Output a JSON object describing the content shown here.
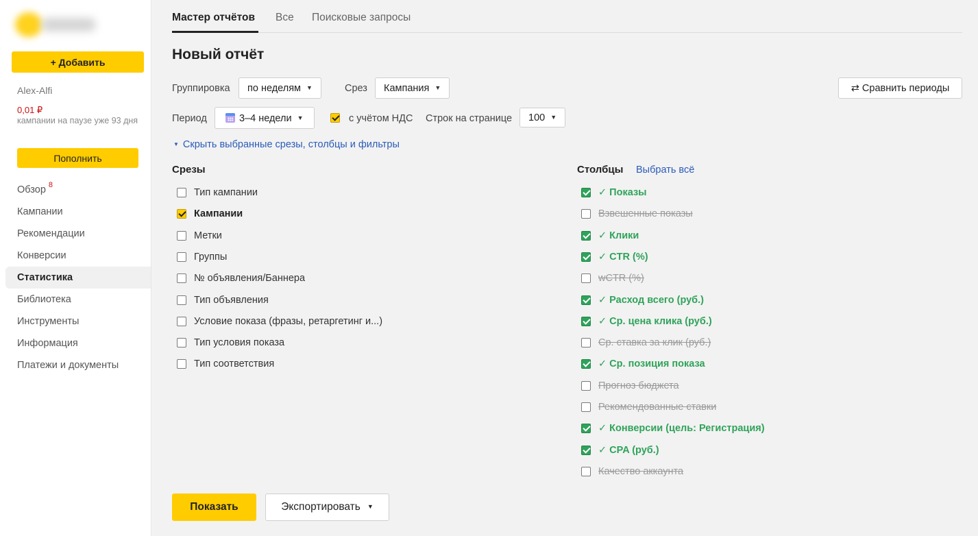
{
  "sidebar": {
    "add_label": "+ Добавить",
    "user": "Alex-Alfi",
    "balance": "0,01 ₽",
    "balance_note": "кампании на паузе уже 93 дня",
    "topup_label": "Пополнить",
    "nav": [
      {
        "label": "Обзор",
        "badge": "8"
      },
      {
        "label": "Кампании"
      },
      {
        "label": "Рекомендации"
      },
      {
        "label": "Конверсии"
      },
      {
        "label": "Статистика",
        "active": true
      },
      {
        "label": "Библиотека"
      },
      {
        "label": "Инструменты"
      },
      {
        "label": "Информация"
      },
      {
        "label": "Платежи и документы"
      }
    ]
  },
  "tabs": [
    {
      "label": "Мастер отчётов",
      "active": true
    },
    {
      "label": "Все"
    },
    {
      "label": "Поисковые запросы"
    }
  ],
  "page_title": "Новый отчёт",
  "filters": {
    "grouping_label": "Группировка",
    "grouping_value": "по неделям",
    "slice_label": "Срез",
    "slice_value": "Кампания",
    "compare_label": "⇄ Сравнить периоды",
    "period_label": "Период",
    "period_value": "3–4 недели",
    "vat_label": "с учётом НДС",
    "vat_checked": true,
    "rows_label": "Строк на странице",
    "rows_value": "100",
    "toggle_link": "Скрыть выбранные срезы, столбцы и фильтры"
  },
  "slices": {
    "title": "Срезы",
    "items": [
      {
        "label": "Тип кампании",
        "checked": false
      },
      {
        "label": "Кампании",
        "checked": true
      },
      {
        "label": "Метки",
        "checked": false
      },
      {
        "label": "Группы",
        "checked": false
      },
      {
        "label": "№ объявления/Баннера",
        "checked": false
      },
      {
        "label": "Тип объявления",
        "checked": false
      },
      {
        "label": "Условие показа (фразы, ретаргетинг и...)",
        "checked": false
      },
      {
        "label": "Тип условия показа",
        "checked": false
      },
      {
        "label": "Тип соответствия",
        "checked": false
      }
    ]
  },
  "columns": {
    "title": "Столбцы",
    "select_all": "Выбрать всё",
    "items": [
      {
        "label": "✓ Показы",
        "checked": true
      },
      {
        "label": "Взвешенные показы",
        "checked": false
      },
      {
        "label": "✓ Клики",
        "checked": true
      },
      {
        "label": "✓ CTR (%)",
        "checked": true
      },
      {
        "label": "wCTR (%)",
        "checked": false
      },
      {
        "label": "✓ Расход всего (руб.)",
        "checked": true
      },
      {
        "label": "✓ Ср. цена клика (руб.)",
        "checked": true
      },
      {
        "label": "Ср. ставка за клик (руб.)",
        "checked": false
      },
      {
        "label": "✓ Ср. позиция показа",
        "checked": true
      },
      {
        "label": "Прогноз бюджета",
        "checked": false
      },
      {
        "label": "Рекомендованные ставки",
        "checked": false
      },
      {
        "label": "✓ Конверсии (цель: Регистрация)",
        "checked": true
      },
      {
        "label": "✓ CPA (руб.)",
        "checked": true
      },
      {
        "label": "Качество аккаунта",
        "checked": false
      }
    ]
  },
  "actions": {
    "show_label": "Показать",
    "export_label": "Экспортировать"
  },
  "colors": {
    "accent_yellow": "#ffcc00",
    "checked_green": "#2fa35a",
    "link_blue": "#2a5bb8",
    "balance_red": "#cc1111"
  }
}
